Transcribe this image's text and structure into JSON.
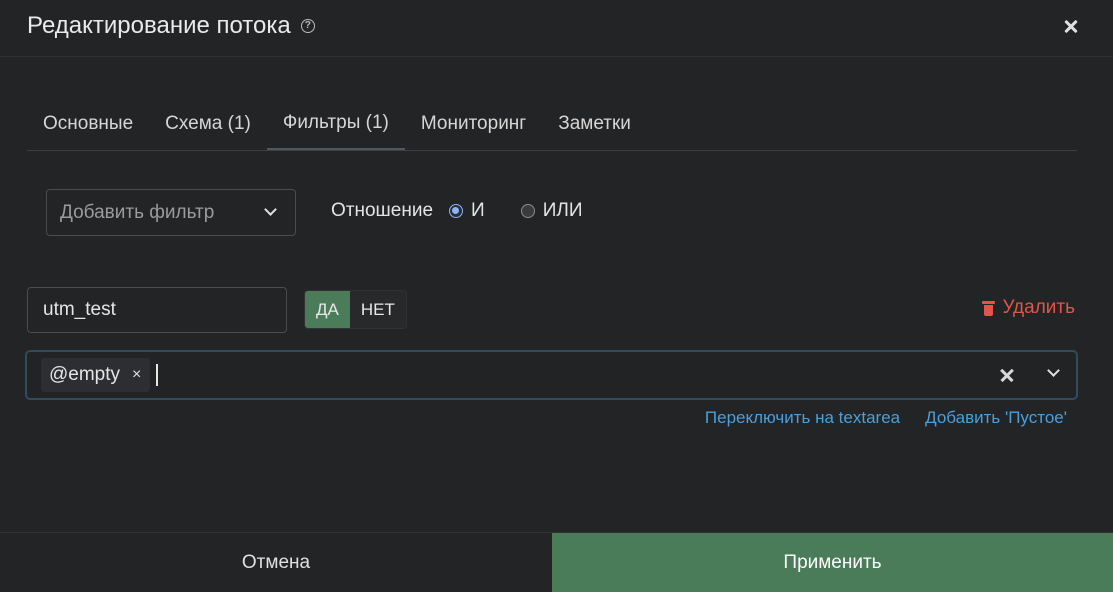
{
  "header": {
    "title": "Редактирование потока",
    "help_icon": "?"
  },
  "tabs": [
    {
      "label": "Основные"
    },
    {
      "label": "Схема (1)"
    },
    {
      "label": "Фильтры (1)",
      "active": true
    },
    {
      "label": "Мониторинг"
    },
    {
      "label": "Заметки"
    }
  ],
  "filter": {
    "add_placeholder": "Добавить фильтр",
    "relation_label": "Отношение",
    "relation_options": [
      {
        "label": "И",
        "selected": true
      },
      {
        "label": "ИЛИ",
        "selected": false
      }
    ]
  },
  "rule": {
    "field_value": "utm_test",
    "toggle_yes": "ДА",
    "toggle_no": "НЕТ",
    "toggle_selected": "ДА",
    "delete_label": "Удалить",
    "tags": [
      {
        "label": "@empty",
        "remove": "×"
      }
    ],
    "switch_textarea_link": "Переключить на textarea",
    "add_empty_link": "Добавить 'Пустое'"
  },
  "footer": {
    "cancel_label": "Отмена",
    "apply_label": "Применить"
  },
  "colors": {
    "background": "#232426",
    "accent_green": "#4a7c59",
    "link_blue": "#4a9fde",
    "danger_red": "#e0564b",
    "radio_blue": "#8ab4f8"
  }
}
